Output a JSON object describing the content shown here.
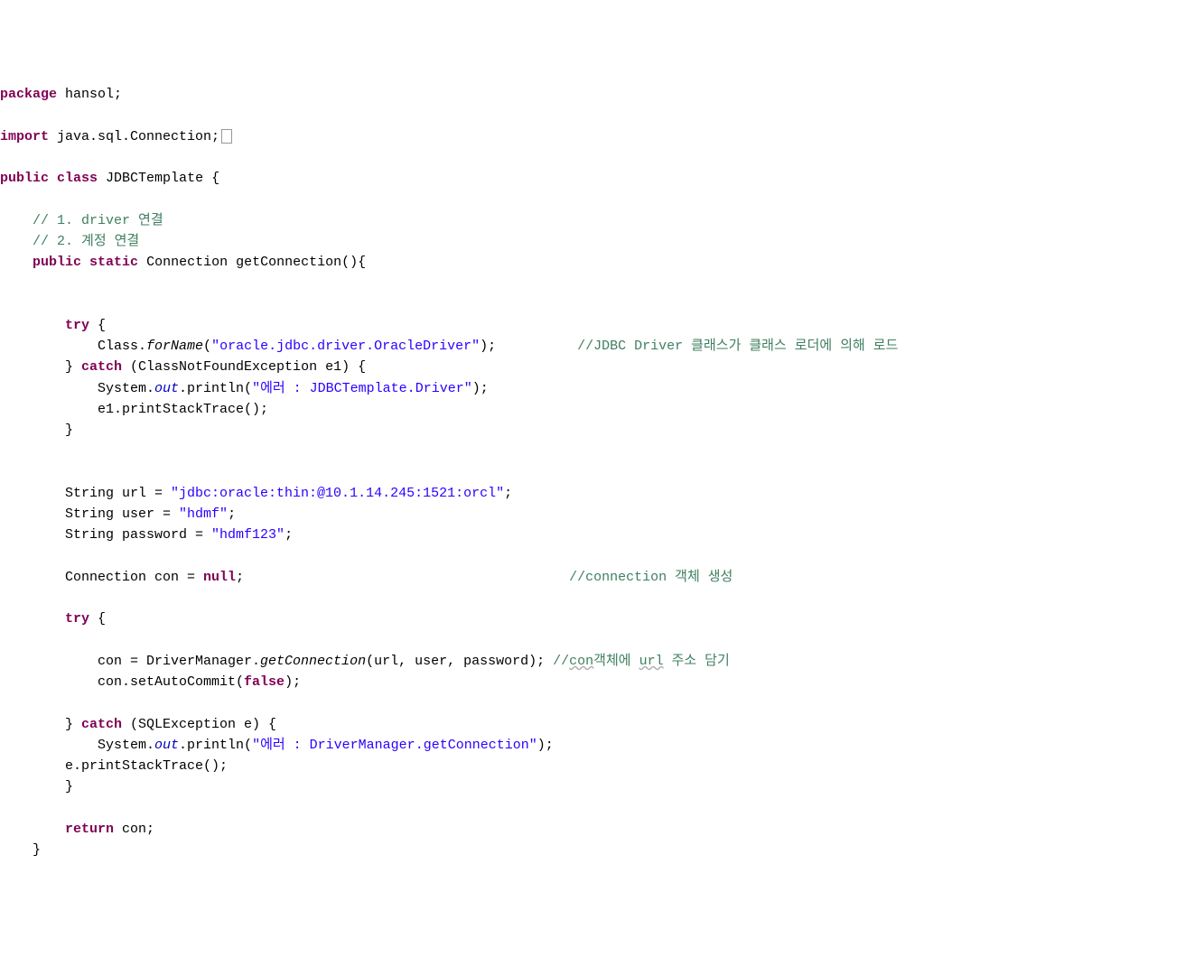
{
  "code": {
    "kw_package": "package",
    "package_name": " hansol;",
    "kw_import": "import",
    "import_stmt": " java.sql.Connection;",
    "kw_public1": "public",
    "kw_class": "class",
    "class_name": " JDBCTemplate {",
    "comment1": "    // 1. driver 연결",
    "comment2": "    // 2. 계정 연결",
    "kw_public2": "public",
    "kw_static": "static",
    "method_sig": " Connection getConnection(){",
    "kw_try1": "try",
    "try1_open": " {",
    "class_forname1": "            Class.",
    "forname_italic": "forName",
    "class_forname2": "(",
    "str_driver": "\"oracle.jdbc.driver.OracleDriver\"",
    "class_forname3": ");          ",
    "comment_jdbc": "//JDBC Driver 클래스가 클래스 로더에 의해 로드",
    "catch1_open": "        } ",
    "kw_catch1": "catch",
    "catch1_sig": " (ClassNotFoundException e1) {",
    "sysout1a": "            System.",
    "out1": "out",
    "sysout1b": ".println(",
    "str_err1": "\"에러 : JDBCTemplate.Driver\"",
    "sysout1c": ");",
    "e1_print": "            e1.printStackTrace();",
    "catch1_close": "        }",
    "url_decl": "        String url = ",
    "str_url": "\"jdbc:oracle:thin:@10.1.14.245:1521:orcl\"",
    "url_end": ";",
    "user_decl": "        String user = ",
    "str_user": "\"hdmf\"",
    "user_end": ";",
    "pwd_decl": "        String password = ",
    "str_pwd": "\"hdmf123\"",
    "pwd_end": ";",
    "con_decl1": "        Connection con = ",
    "kw_null": "null",
    "con_decl2": ";                                        ",
    "comment_conn": "//connection 객체 생성",
    "kw_try2": "try",
    "try2_open": " {",
    "con_assign1": "            con = DriverManager.",
    "getconn_italic": "getConnection",
    "con_assign2": "(url, user, password); ",
    "comment_con1": "//",
    "con_underline": "con",
    "comment_con2": "객체에 ",
    "url_underline": "url",
    "comment_con3": " 주소 담기",
    "autocommit1": "            con.setAutoCommit(",
    "kw_false": "false",
    "autocommit2": ");",
    "catch2_open": "        } ",
    "kw_catch2": "catch",
    "catch2_sig": " (SQLException e) {",
    "sysout2a": "            System.",
    "out2": "out",
    "sysout2b": ".println(",
    "str_err2": "\"에러 : DriverManager.getConnection\"",
    "sysout2c": ");",
    "e_print": "        e.printStackTrace();",
    "catch2_close": "        }",
    "kw_return": "return",
    "return_stmt": " con;",
    "method_close": "    }"
  }
}
